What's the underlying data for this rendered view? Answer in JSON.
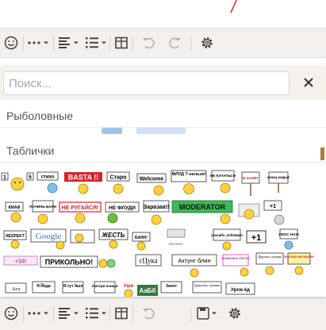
{
  "toolbar": {
    "buttons": [
      {
        "name": "emoji-button",
        "icon": "smiley-icon"
      },
      {
        "name": "more-button",
        "icon": "ellipsis-icon"
      },
      {
        "name": "align-button",
        "icon": "align-left-icon"
      },
      {
        "name": "list-button",
        "icon": "bulleted-list-icon"
      },
      {
        "name": "table-button",
        "icon": "table-icon"
      },
      {
        "name": "undo-button",
        "icon": "undo-icon"
      },
      {
        "name": "redo-button",
        "icon": "redo-icon"
      },
      {
        "name": "settings-button",
        "icon": "gear-icon"
      }
    ]
  },
  "bottom_toolbar": {
    "buttons": [
      {
        "name": "emoji-button",
        "icon": "smiley-icon"
      },
      {
        "name": "more-button",
        "icon": "ellipsis-icon"
      },
      {
        "name": "align-button",
        "icon": "align-left-icon"
      },
      {
        "name": "list-button",
        "icon": "bulleted-list-icon"
      },
      {
        "name": "table-button",
        "icon": "table-icon"
      },
      {
        "name": "undo-button",
        "icon": "undo-icon"
      },
      {
        "name": "save-button",
        "icon": "floppy-icon"
      },
      {
        "name": "settings-button",
        "icon": "gear-icon"
      }
    ]
  },
  "emoji_popup": {
    "search_placeholder": "Поиск...",
    "close_icon": "close-icon",
    "categories": [
      "Рыболовные",
      "Таблички"
    ],
    "smileys": [
      "стихо",
      "BASTA !!",
      "Старо",
      "Welcome",
      "ФЛУД ? нельзя!",
      "НЕ КУПАТЬСЯ",
      "В ЗАНЯТ",
      "конец закрыт",
      "КМАФ",
      "ПОЧИНЬ БАЯН",
      "НЕ РУГАЙСЯ!",
      "НЕ ФЛУДИ",
      "Заразаа!!",
      "MODERATOR",
      "+1",
      "RESPEKT",
      "Google",
      "ЖЕСТЬ",
      "БАЯН!",
      "Респект!",
      "спасибо, поблевал",
      "+1",
      "УЖОС НАХ!",
      "+10!",
      "ПРИКОЛЬНО!",
      "сЦука",
      "Актунг блин",
      "внимание понты",
      "Дурдом, однако",
      "ЗНАТНО НЕ ВЫЕЯ!",
      "Ага",
      "Я Йода",
      "Я тут был",
      "Смотри поищи",
      "Уши",
      "АаБб",
      "Зачот",
      "Дурдомъ, однакъ",
      "Урхм ёд"
    ]
  },
  "colors": {
    "toolbar_bg": "#f3efed",
    "search_row_bg": "#f6f1ea",
    "scroll_accent": "#b07a3a",
    "moderator_green": "#3db85a",
    "basta_red": "#d9212a"
  }
}
